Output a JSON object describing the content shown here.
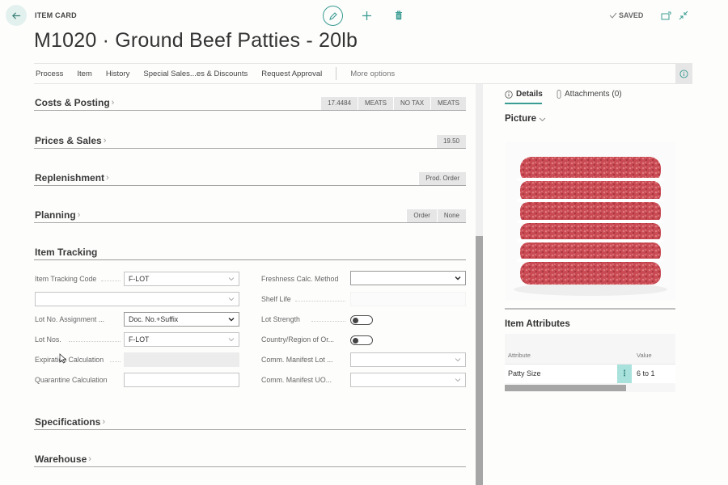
{
  "header": {
    "caption": "ITEM CARD",
    "title": "M1020 · Ground Beef Patties - 20lb",
    "status": "SAVED",
    "icons": {
      "back": "arrow-left-icon",
      "edit": "pencil-icon",
      "new": "plus-icon",
      "delete": "trash-icon",
      "saved": "checkmark-icon",
      "popout": "open-in-new-window-icon",
      "collapse": "collapse-arrows-icon"
    }
  },
  "actionbar": {
    "actions": [
      "Process",
      "Item",
      "History",
      "Special Sales...es & Discounts",
      "Request Approval"
    ],
    "more": "More options",
    "info_icon": "info-icon"
  },
  "fasttabs": [
    {
      "title": "Costs & Posting",
      "summary": [
        "17.4484",
        "MEATS",
        "NO TAX",
        "MEATS"
      ]
    },
    {
      "title": "Prices & Sales",
      "summary": [
        "19.50"
      ]
    },
    {
      "title": "Replenishment",
      "summary": [
        "Prod. Order"
      ]
    },
    {
      "title": "Planning",
      "summary": [
        "Order",
        "None"
      ]
    }
  ],
  "item_tracking": {
    "title": "Item Tracking",
    "left": [
      {
        "label": "Item Tracking Code",
        "value": "F-LOT",
        "type": "lookup"
      },
      {
        "label": "",
        "value": "",
        "type": "lookup"
      },
      {
        "label": "Lot No. Assignment ...",
        "value": "Doc. No.+Suffix",
        "type": "select"
      },
      {
        "label": "Lot Nos.",
        "value": "F-LOT",
        "type": "lookup"
      },
      {
        "label": "Expiration Calculation",
        "value": "",
        "type": "disabled"
      },
      {
        "label": "Quarantine Calculation",
        "value": "",
        "type": "text"
      }
    ],
    "right": [
      {
        "label": "Freshness Calc. Method",
        "value": "",
        "type": "select"
      },
      {
        "label": "Shelf Life",
        "value": "",
        "type": "readonly"
      },
      {
        "label": "Lot Strength",
        "value": false,
        "type": "toggle"
      },
      {
        "label": "Country/Region of Or...",
        "value": false,
        "type": "toggle"
      },
      {
        "label": "Comm. Manifest Lot ...",
        "value": "",
        "type": "lookup"
      },
      {
        "label": "Comm. Manifest UO...",
        "value": "",
        "type": "lookup"
      }
    ]
  },
  "fasttabs_bottom": [
    {
      "title": "Specifications"
    },
    {
      "title": "Warehouse"
    }
  ],
  "factbox": {
    "tabs": [
      {
        "label": "Details",
        "icon": "info-icon",
        "active": true
      },
      {
        "label": "Attachments (0)",
        "icon": "paperclip-icon",
        "active": false
      }
    ],
    "picture": {
      "title": "Picture",
      "alt": "Stack of raw ground beef patties"
    },
    "attributes": {
      "title": "Item Attributes",
      "columns": [
        "Attribute",
        "Value"
      ],
      "rows": [
        {
          "attribute": "Patty Size",
          "value": "6 to 1"
        }
      ]
    }
  },
  "colors": {
    "accent": "#3a9c92",
    "accent_light": "#a9e2dc",
    "chip_bg": "#e6e6e6",
    "divider": "#a6a6a6"
  }
}
